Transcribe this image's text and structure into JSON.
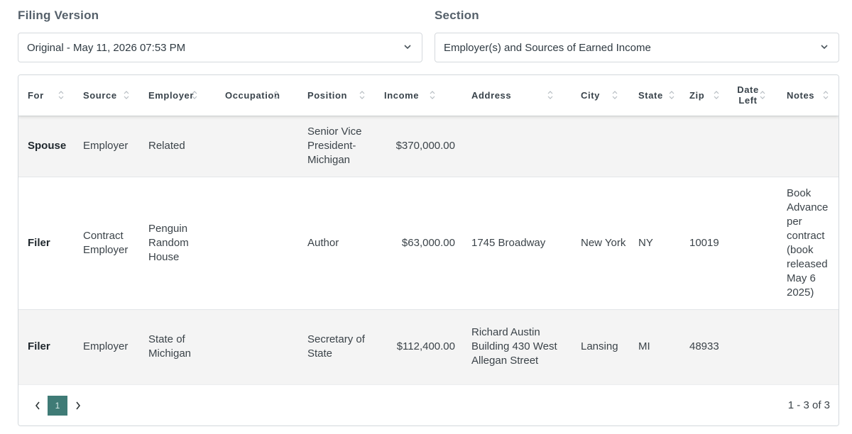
{
  "filters": {
    "filing_version_label": "Filing Version",
    "filing_version_value": "Original - May 11, 2026 07:53 PM",
    "section_label": "Section",
    "section_value": "Employer(s) and Sources of Earned Income"
  },
  "table": {
    "columns": [
      "For",
      "Source",
      "Employer",
      "Occupation",
      "Position",
      "Income",
      "Address",
      "City",
      "State",
      "Zip",
      "Date Left",
      "Notes"
    ],
    "rows": [
      {
        "for": "Spouse",
        "source": "Employer",
        "employer": "Related",
        "occupation": "",
        "position": "Senior Vice President-Michigan",
        "income": "$370,000.00",
        "address": "",
        "city": "",
        "state": "",
        "zip": "",
        "date_left": "",
        "notes": ""
      },
      {
        "for": "Filer",
        "source": "Contract Employer",
        "employer": "Penguin Random House",
        "occupation": "",
        "position": "Author",
        "income": "$63,000.00",
        "address": "1745 Broadway",
        "city": "New York",
        "state": "NY",
        "zip": "10019",
        "date_left": "",
        "notes": "Book Advance per contract (book released May 6 2025)"
      },
      {
        "for": "Filer",
        "source": "Employer",
        "employer": "State of Michigan",
        "occupation": "",
        "position": "Secretary of State",
        "income": "$112,400.00",
        "address": "Richard Austin Building 430 West Allegan Street",
        "city": "Lansing",
        "state": "MI",
        "zip": "48933",
        "date_left": "",
        "notes": ""
      }
    ]
  },
  "pagination": {
    "current_page": "1",
    "range_text": "1 - 3 of 3",
    "prev_icon": "chevron-left-icon",
    "next_icon": "chevron-right-icon"
  },
  "colors": {
    "accent": "#3f7b76",
    "row_alt": "#f4f4f4",
    "label": "#55606a"
  }
}
